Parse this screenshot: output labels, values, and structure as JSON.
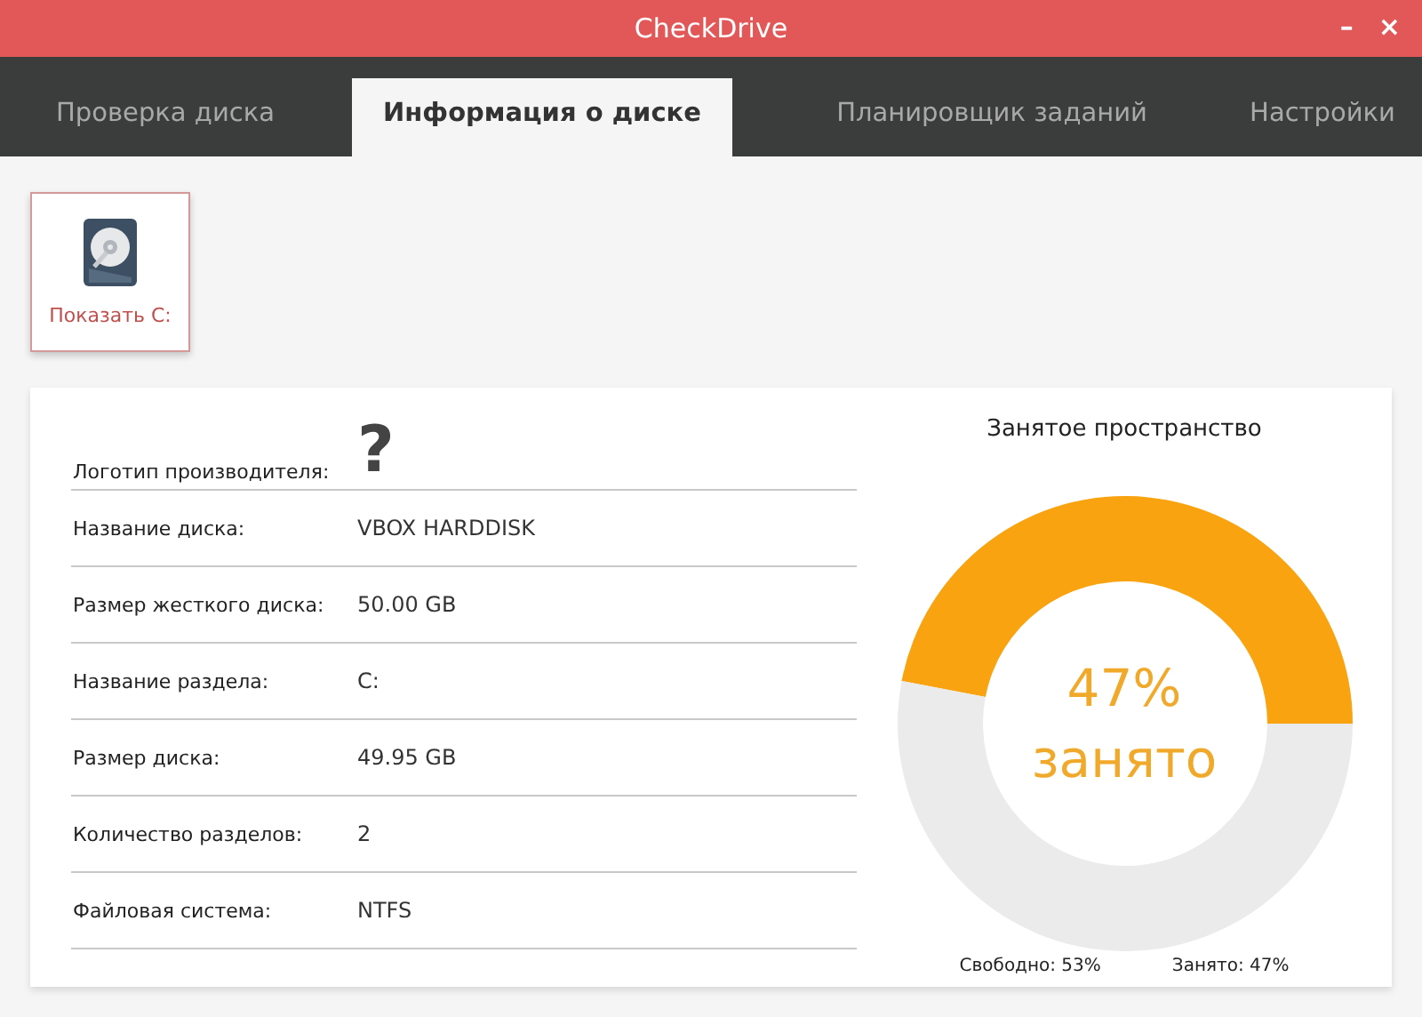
{
  "window": {
    "title": "CheckDrive",
    "controls": [
      "–",
      "×"
    ]
  },
  "tabs": [
    {
      "label": "Проверка диска",
      "selected": false
    },
    {
      "label": "Информация о диске",
      "selected": true
    },
    {
      "label": "Планировщик заданий",
      "selected": false
    },
    {
      "label": "Настройки",
      "selected": false
    }
  ],
  "drive_button": {
    "label": "Показать C:"
  },
  "info": [
    {
      "kind": "icon",
      "label": "Логотип производителя:",
      "value": "?"
    },
    {
      "kind": "text",
      "label": "Название диска:",
      "value": "VBOX HARDDISK"
    },
    {
      "kind": "text",
      "label": "Размер жесткого диска:",
      "value": "50.00 GB"
    },
    {
      "kind": "text",
      "label": "Название раздела:",
      "value": "C:"
    },
    {
      "kind": "text",
      "label": "Размер диска:",
      "value": "49.95 GB"
    },
    {
      "kind": "text",
      "label": "Количество разделов:",
      "value": "2"
    },
    {
      "kind": "text",
      "label": "Файловая система:",
      "value": "NTFS"
    }
  ],
  "usage": {
    "chart_data": {
      "type": "donut",
      "title": "Занятое пространство",
      "values": [
        47,
        53
      ]
    },
    "percent": "47%",
    "caption": "занято",
    "legend": [
      "Свободно: 53%",
      "Занято: 47%"
    ]
  }
}
